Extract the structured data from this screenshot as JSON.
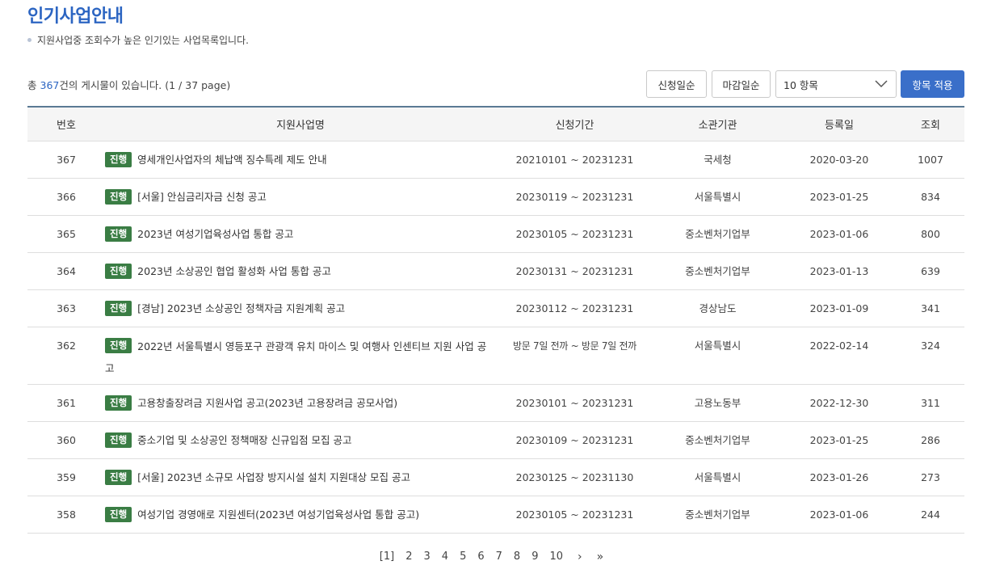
{
  "page": {
    "title": "인기사업안내",
    "description": "지원사업중 조회수가 높은 인기있는 사업목록입니다."
  },
  "summary": {
    "prefix": "총",
    "count": "367",
    "suffix": "건의 게시물이 있습니다. (1 / 37 page)"
  },
  "toolbar": {
    "sort_apply_date": "신청일순",
    "sort_deadline": "마감일순",
    "page_size_selected": "10 항목",
    "apply_label": "항목 적용"
  },
  "table": {
    "headers": [
      "번호",
      "지원사업명",
      "신청기간",
      "소관기관",
      "등록일",
      "조회"
    ],
    "rows": [
      {
        "no": "367",
        "status": "진행",
        "title": "영세개인사업자의 체납액 징수특례 제도 안내",
        "period": "20210101 ~ 20231231",
        "agency": "국세청",
        "date": "2020-03-20",
        "views": "1007"
      },
      {
        "no": "366",
        "status": "진행",
        "title": "[서울] 안심금리자금 신청 공고",
        "period": "20230119 ~ 20231231",
        "agency": "서울특별시",
        "date": "2023-01-25",
        "views": "834"
      },
      {
        "no": "365",
        "status": "진행",
        "title": "2023년 여성기업육성사업 통합 공고",
        "period": "20230105 ~ 20231231",
        "agency": "중소벤처기업부",
        "date": "2023-01-06",
        "views": "800"
      },
      {
        "no": "364",
        "status": "진행",
        "title": "2023년 소상공인 협업 활성화 사업 통합 공고",
        "period": "20230131 ~ 20231231",
        "agency": "중소벤처기업부",
        "date": "2023-01-13",
        "views": "639"
      },
      {
        "no": "363",
        "status": "진행",
        "title": "[경남] 2023년 소상공인 정책자금 지원계획 공고",
        "period": "20230112 ~ 20231231",
        "agency": "경상남도",
        "date": "2023-01-09",
        "views": "341"
      },
      {
        "no": "362",
        "status": "진행",
        "title": "2022년 서울특별시 영등포구 관광객 유치 마이스 및 여행사 인센티브 지원 사업 공고",
        "period": "방문 7일 전까 ~ 방문 7일 전까",
        "agency": "서울특별시",
        "date": "2022-02-14",
        "views": "324"
      },
      {
        "no": "361",
        "status": "진행",
        "title": "고용창출장려금 지원사업 공고(2023년 고용장려금 공모사업)",
        "period": "20230101 ~ 20231231",
        "agency": "고용노동부",
        "date": "2022-12-30",
        "views": "311"
      },
      {
        "no": "360",
        "status": "진행",
        "title": "중소기업 및 소상공인 정책매장 신규입점 모집 공고",
        "period": "20230109 ~ 20231231",
        "agency": "중소벤처기업부",
        "date": "2023-01-25",
        "views": "286"
      },
      {
        "no": "359",
        "status": "진행",
        "title": "[서울] 2023년 소규모 사업장 방지시설 설치 지원대상 모집 공고",
        "period": "20230125 ~ 20231130",
        "agency": "서울특별시",
        "date": "2023-01-26",
        "views": "273"
      },
      {
        "no": "358",
        "status": "진행",
        "title": "여성기업 경영애로 지원센터(2023년 여성기업육성사업 통합 공고)",
        "period": "20230105 ~ 20231231",
        "agency": "중소벤처기업부",
        "date": "2023-01-06",
        "views": "244"
      }
    ]
  },
  "pagination": {
    "current": "[1]",
    "pages": [
      "2",
      "3",
      "4",
      "5",
      "6",
      "7",
      "8",
      "9",
      "10"
    ],
    "next": "›",
    "last": "»"
  }
}
